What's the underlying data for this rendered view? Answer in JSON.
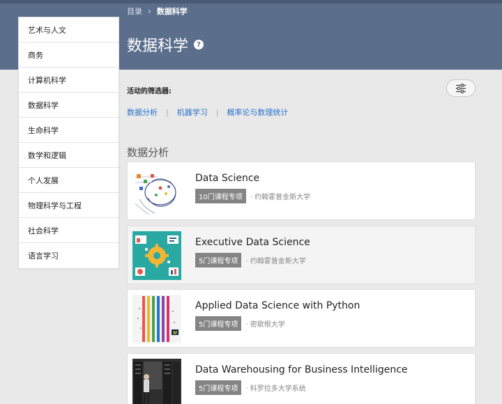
{
  "breadcrumb": {
    "root": "目录",
    "separator": "›",
    "current": "数据科学"
  },
  "page_title": "数据科学",
  "help_icon": "?",
  "sidebar": {
    "items": [
      {
        "label": "艺术与人文"
      },
      {
        "label": "商务"
      },
      {
        "label": "计算机科学"
      },
      {
        "label": "数据科学"
      },
      {
        "label": "生命科学"
      },
      {
        "label": "数学和逻辑"
      },
      {
        "label": "个人发展"
      },
      {
        "label": "物理科学与工程"
      },
      {
        "label": "社会科学"
      },
      {
        "label": "语言学习"
      }
    ]
  },
  "filters": {
    "label": "活动的筛选器:",
    "separator": "|",
    "items": [
      {
        "label": "数据分析"
      },
      {
        "label": "机器学习"
      },
      {
        "label": "概率论与数理统计"
      }
    ],
    "icon": "sliders-icon"
  },
  "section": {
    "title": "数据分析"
  },
  "courses": [
    {
      "title": "Data Science",
      "badge": "10门课程专项",
      "provider": "· 约翰霍普金斯大学"
    },
    {
      "title": "Executive Data Science",
      "badge": "5门课程专项",
      "provider": "· 约翰霍普金斯大学"
    },
    {
      "title": "Applied Data Science with Python",
      "badge": "5门课程专项",
      "provider": "· 密歇根大学"
    },
    {
      "title": "Data Warehousing for Business Intelligence",
      "badge": "5门课程专项",
      "provider": "· 科罗拉多大学系统"
    }
  ],
  "colors": {
    "banner": "#5b6e8c",
    "link": "#2a73cc",
    "badge": "#848484"
  }
}
